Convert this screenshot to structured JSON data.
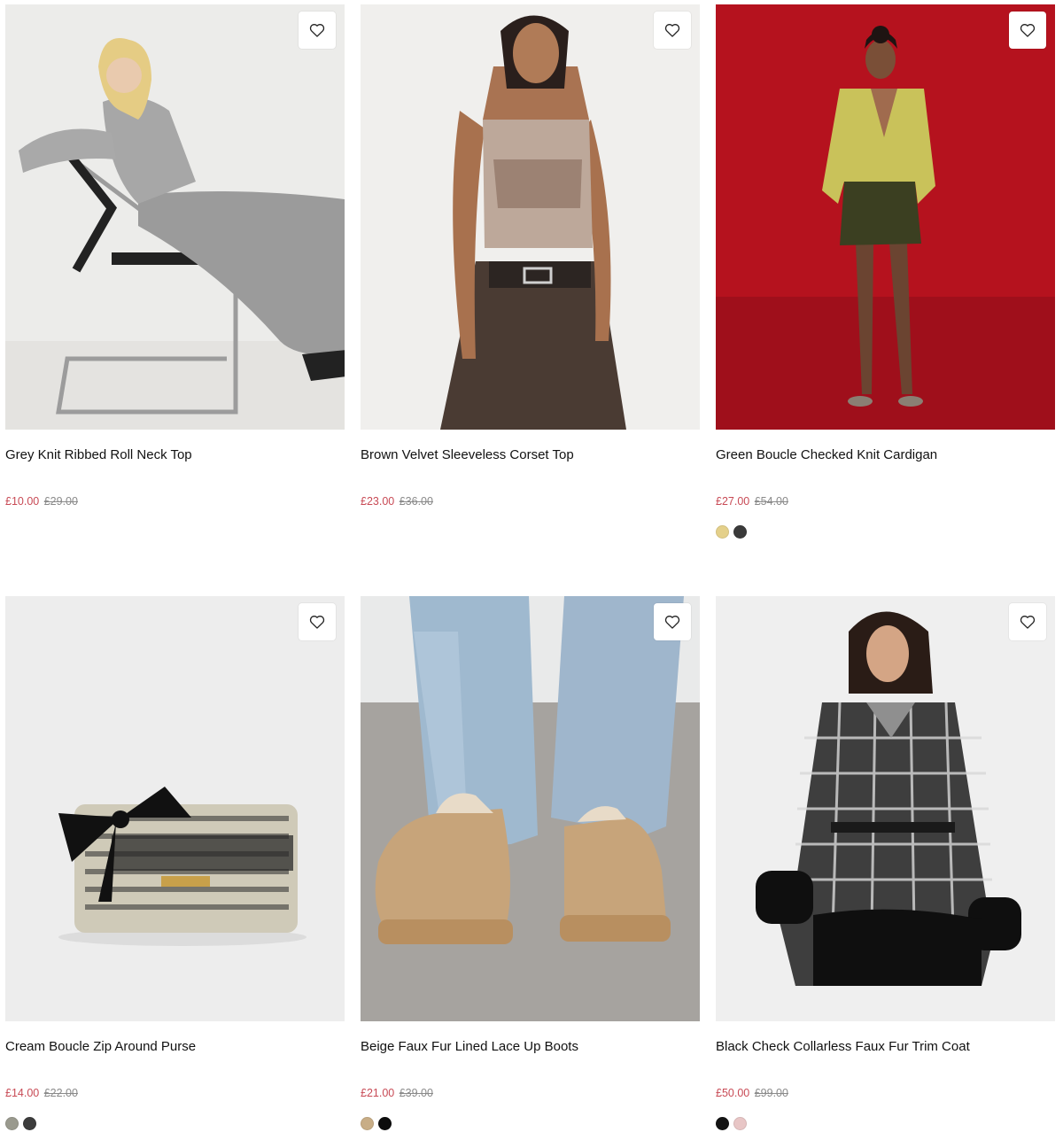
{
  "products": [
    {
      "name": "Grey Knit Ribbed Roll Neck Top",
      "sale_price": "£10.00",
      "original_price": "£29.00",
      "image_bg": "#ececea",
      "swatches": []
    },
    {
      "name": "Brown Velvet Sleeveless Corset Top",
      "sale_price": "£23.00",
      "original_price": "£36.00",
      "image_bg": "#f0efed",
      "swatches": []
    },
    {
      "name": "Green Boucle Checked Knit Cardigan",
      "sale_price": "£27.00",
      "original_price": "£54.00",
      "image_bg": "#b5121e",
      "swatches": [
        "#e4d08a",
        "#3a3a3a"
      ]
    },
    {
      "name": "Cream Boucle Zip Around Purse",
      "sale_price": "£14.00",
      "original_price": "£22.00",
      "image_bg": "#ededed",
      "swatches": [
        "#9a9a8e",
        "#3c3c3c"
      ]
    },
    {
      "name": "Beige Faux Fur Lined Lace Up Boots",
      "sale_price": "£21.00",
      "original_price": "£39.00",
      "image_bg": "#a6a39f",
      "swatches": [
        "#c8ad86",
        "#0d0d0d"
      ]
    },
    {
      "name": "Black Check Collarless Faux Fur Trim Coat",
      "sale_price": "£50.00",
      "original_price": "£99.00",
      "image_bg": "#efefef",
      "swatches": [
        "#141414",
        "#e8c6c6"
      ]
    }
  ],
  "wishlist_icon": "heart-outline-icon",
  "colors": {
    "sale": "#c84a55",
    "was": "#8a8a8a"
  }
}
